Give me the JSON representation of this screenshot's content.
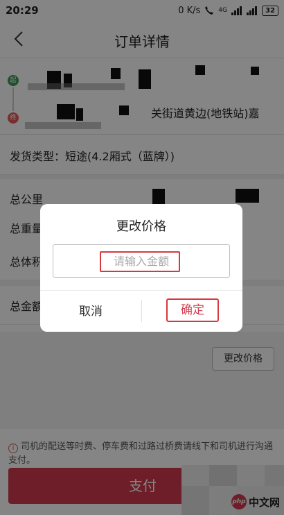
{
  "status_bar": {
    "time": "20:29",
    "speed": "0 K/s",
    "network": "4G",
    "battery": "32"
  },
  "header": {
    "title": "订单详情"
  },
  "route": {
    "end_text": "关街道黄边(地铁站)嘉"
  },
  "order": {
    "ship_type": "发货类型：短途(4.2厢式（蓝牌）)",
    "total_km_label": "总公里",
    "total_weight_label": "总重量",
    "total_volume_label": "总体积",
    "total_amount_label": "总金额"
  },
  "actions": {
    "change_price": "更改价格",
    "pay": "支付"
  },
  "notice": {
    "text": "司机的配送等时费、停车费和过路过桥费请线下和司机进行沟通支付。"
  },
  "dialog": {
    "title": "更改价格",
    "placeholder": "请输入金额",
    "cancel": "取消",
    "confirm": "确定"
  },
  "watermark": {
    "text": "中文网",
    "badge": "php"
  },
  "colors": {
    "accent": "#d23a4e",
    "highlight": "#d7383c",
    "start_dot": "#3d9b58",
    "end_dot": "#e25b5b"
  }
}
